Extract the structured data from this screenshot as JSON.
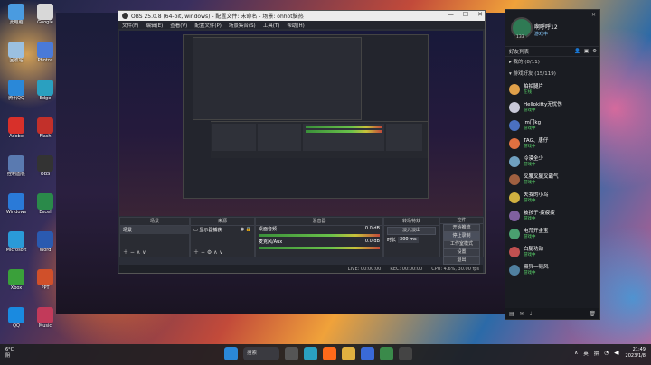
{
  "desktop": {
    "col1": [
      {
        "label": "此电脑",
        "color": "#4a9be0"
      },
      {
        "label": "回收站",
        "color": "#9bc0e0"
      },
      {
        "label": "腾讯QQ",
        "color": "#2a88d8"
      },
      {
        "label": "Adobe",
        "color": "#d8302a"
      },
      {
        "label": "控制面板",
        "color": "#5a7ab0"
      },
      {
        "label": "Windows",
        "color": "#2a7ad8"
      },
      {
        "label": "Microsoft",
        "color": "#2a9ad8"
      },
      {
        "label": "Xbox",
        "color": "#3aa03a"
      },
      {
        "label": "QQ",
        "color": "#1a8ae0"
      }
    ],
    "col2": [
      {
        "label": "Google",
        "color": "#d8d8d8"
      },
      {
        "label": "Photos",
        "color": "#4a7ad8"
      },
      {
        "label": "Edge",
        "color": "#2aa0c0"
      },
      {
        "label": "Flash",
        "color": "#c2302a"
      },
      {
        "label": "OBS",
        "color": "#333"
      },
      {
        "label": "Excel",
        "color": "#2a8a4a"
      },
      {
        "label": "Word",
        "color": "#2a5ab0"
      },
      {
        "label": "PPT",
        "color": "#d0502a"
      },
      {
        "label": "Music",
        "color": "#c23a5a"
      }
    ]
  },
  "obs": {
    "title": "OBS 25.0.8 (64-bit, windows) - 配置文件: 未命名 - 场景: ohhot脑热",
    "menu": [
      "文件(F)",
      "编辑(E)",
      "查看(V)",
      "配置文件(P)",
      "场景集合(S)",
      "工具(T)",
      "帮助(H)"
    ],
    "docks": {
      "scenes": {
        "title": "场景",
        "items": [
          "场景"
        ]
      },
      "sources": {
        "title": "来源",
        "items": [
          "显示器捕获"
        ]
      },
      "mixer": {
        "title": "混音器",
        "track1": "桌面音频",
        "track1_db": "0.0 dB",
        "track2": "麦克风/Aux",
        "track2_db": "0.0 dB"
      },
      "transitions": {
        "title": "转场特效",
        "type": "淡入淡出",
        "duration_label": "时长",
        "duration": "300 ms"
      },
      "controls": {
        "title": "控件",
        "buttons": [
          "开始推流",
          "停止录制",
          "工作室模式",
          "设置",
          "退出"
        ]
      }
    },
    "status": {
      "live": "LIVE: 00:00:00",
      "rec": "REC: 00:00:00",
      "cpu": "CPU: 4.6%, 30.00 fps"
    }
  },
  "qq": {
    "name": "啊呼呼12",
    "level": "133",
    "status": "游戏中",
    "tabs_label": "好友列表",
    "groups": [
      {
        "label": "▸ 我的 (8/11)"
      },
      {
        "label": "▾ 游戏好友 (15/119)"
      }
    ],
    "friends": [
      {
        "name": "拍拍腿片",
        "status": "在线",
        "color": "#e0a04a"
      },
      {
        "name": "Hellokitty无忧伤",
        "status": "游戏中",
        "color": "#c8c8d8"
      },
      {
        "name": "lm门kg",
        "status": "游戏中",
        "color": "#4a70c0"
      },
      {
        "name": "TAG、唐仔",
        "status": "游戏中",
        "color": "#e07040"
      },
      {
        "name": "冷漠全少",
        "status": "游戏中",
        "color": "#70a0c0"
      },
      {
        "name": "叉腰叉腿叉霸气",
        "status": "游戏中",
        "color": "#a06040"
      },
      {
        "name": "失我的小鸟",
        "status": "游戏中",
        "color": "#d0b040"
      },
      {
        "name": "被孩子·疲疲疲",
        "status": "游戏中",
        "color": "#8060a0"
      },
      {
        "name": "电荒开金宝",
        "status": "游戏中",
        "color": "#4aa070"
      },
      {
        "name": "白腿功勋",
        "status": "游戏中",
        "color": "#c05050"
      },
      {
        "name": "殿冥一顿风",
        "status": "游戏中",
        "color": "#5080a0"
      }
    ]
  },
  "taskbar": {
    "weather_temp": "6°C",
    "weather_desc": "阴",
    "search_label": "搜索",
    "ime1": "英",
    "ime2": "拼",
    "time": "21:49",
    "date": "2023/1/8"
  }
}
